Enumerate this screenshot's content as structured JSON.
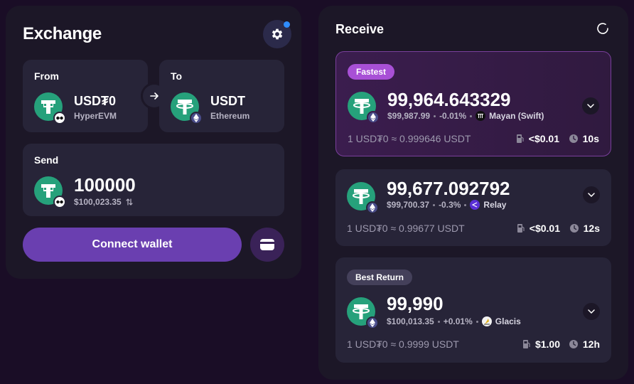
{
  "exchange": {
    "title": "Exchange",
    "from": {
      "label": "From",
      "token": "USD₮0",
      "network": "HyperEVM"
    },
    "to": {
      "label": "To",
      "token": "USDT",
      "network": "Ethereum"
    },
    "send": {
      "label": "Send",
      "amount": "100000",
      "usd": "$100,023.35"
    },
    "connect_label": "Connect wallet"
  },
  "receive": {
    "title": "Receive",
    "quotes": [
      {
        "badge": "Fastest",
        "amount": "99,964.643329",
        "usd": "$99,987.99",
        "change": "-0.01%",
        "provider": "Mayan (Swift)",
        "rate": "1 USD₮0 ≈ 0.999646 USDT",
        "fee": "<$0.01",
        "time": "10s"
      },
      {
        "badge": "",
        "amount": "99,677.092792",
        "usd": "$99,700.37",
        "change": "-0.3%",
        "provider": "Relay",
        "rate": "1 USD₮0 ≈ 0.99677 USDT",
        "fee": "<$0.01",
        "time": "12s"
      },
      {
        "badge": "Best Return",
        "amount": "99,990",
        "usd": "$100,013.35",
        "change": "+0.01%",
        "provider": "Glacis",
        "rate": "1 USD₮0 ≈ 0.9999 USDT",
        "fee": "$1.00",
        "time": "12h"
      }
    ]
  },
  "colors": {
    "background": "#1a0d26",
    "panel": "#1c1727",
    "card": "#272438",
    "accent": "#6a3fb0",
    "fastest_badge": "#a850d6",
    "tether_green": "#26a17b",
    "settings_dot": "#2f8cff"
  },
  "icons": [
    "gear-icon",
    "arrow-right-icon",
    "usdt0-token-icon",
    "usdt-token-icon",
    "hyperevm-network-icon",
    "ethereum-network-icon",
    "swap-arrows-icon",
    "wallet-icon",
    "refresh-icon",
    "chevron-down-icon",
    "gas-pump-icon",
    "clock-icon",
    "mayan-logo-icon",
    "relay-logo-icon",
    "glacis-logo-icon"
  ]
}
